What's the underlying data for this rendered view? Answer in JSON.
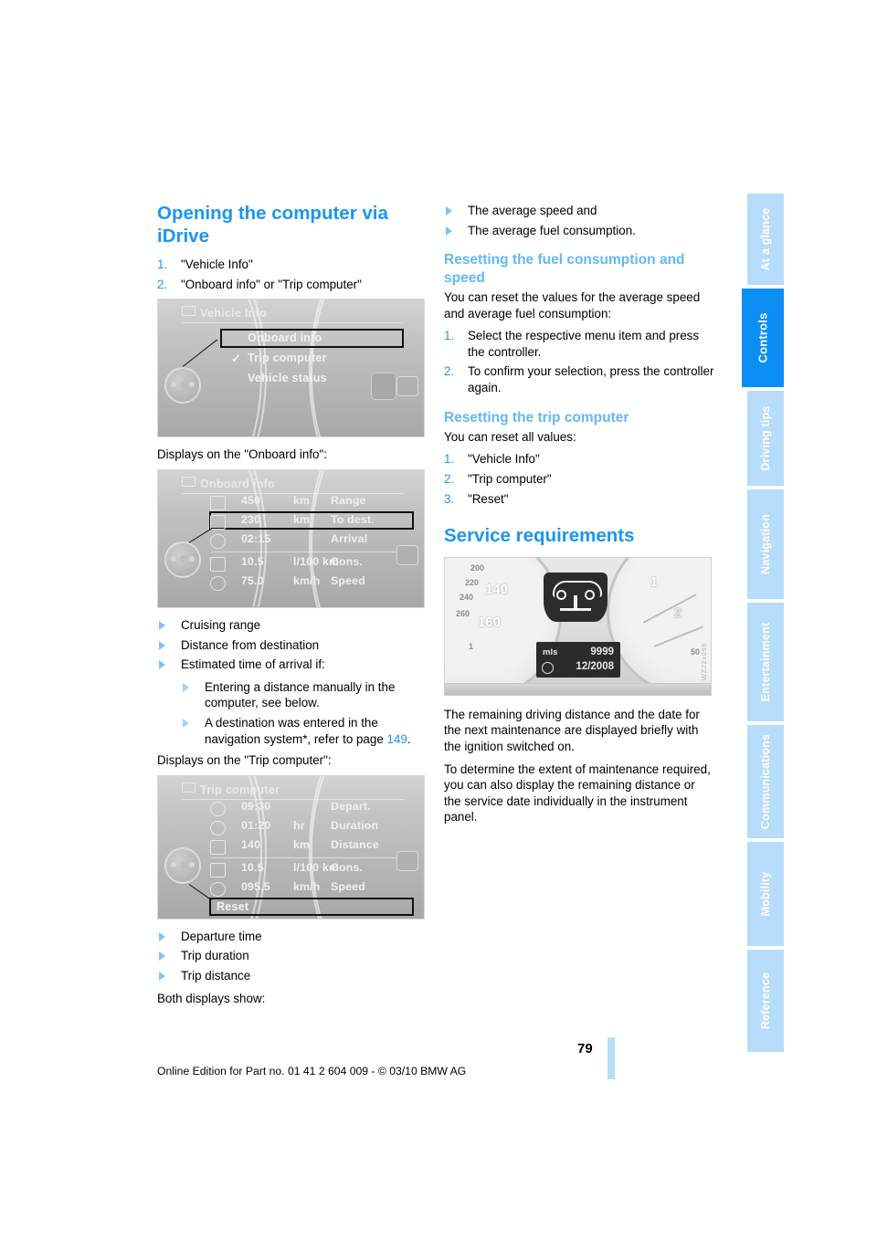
{
  "sidebar": {
    "tabs": [
      {
        "label": "At a glance",
        "active": false
      },
      {
        "label": "Controls",
        "active": true
      },
      {
        "label": "Driving tips",
        "active": false
      },
      {
        "label": "Navigation",
        "active": false
      },
      {
        "label": "Entertainment",
        "active": false
      },
      {
        "label": "Communications",
        "active": false
      },
      {
        "label": "Mobility",
        "active": false
      },
      {
        "label": "Reference",
        "active": false
      }
    ],
    "active_color": "#0b8ff5",
    "inactive_color": "#b8dcfb"
  },
  "left": {
    "heading": "Opening the computer via iDrive",
    "steps": [
      {
        "num": "1.",
        "text": "\"Vehicle Info\""
      },
      {
        "num": "2.",
        "text": "\"Onboard info\" or \"Trip computer\""
      }
    ],
    "caption_onboard": "Displays on the \"Onboard info\":",
    "caption_trip": "Displays on the \"Trip computer\":",
    "bullets_onboard": [
      "Cruising range",
      "Distance from destination",
      "Estimated time of arrival if:"
    ],
    "bullets_nested": [
      {
        "text": "Entering a distance manually in the computer, see below."
      },
      {
        "pre": "A destination was entered in the navigation system",
        "ast": "*",
        "mid": ", refer to page ",
        "page": "149",
        "post": "."
      }
    ],
    "bullets_trip": [
      "Departure time",
      "Trip duration",
      "Trip distance"
    ],
    "both_caption": "Both displays show:"
  },
  "figures": {
    "vehicle_info": {
      "title": "Vehicle Info",
      "items": [
        {
          "label": "Onboard info",
          "selected": true,
          "checked": false
        },
        {
          "label": "Trip computer",
          "selected": false,
          "checked": true
        },
        {
          "label": "Vehicle status",
          "selected": false,
          "checked": false
        }
      ]
    },
    "onboard_info": {
      "title": "Onboard info",
      "rows": [
        {
          "value": "450",
          "unit": "km",
          "label": "Range",
          "selected": false
        },
        {
          "value": "230",
          "unit": "km",
          "label": "To dest.",
          "selected": true
        },
        {
          "value": "02:15",
          "unit": "",
          "label": "Arrival",
          "selected": false
        },
        {
          "value": "10.5",
          "unit": "l/100 km",
          "label": "Cons.",
          "selected": false
        },
        {
          "value": "75.0",
          "unit": "km/h",
          "label": "Speed",
          "selected": false
        }
      ]
    },
    "trip_computer": {
      "title": "Trip computer",
      "rows": [
        {
          "value": "09:30",
          "unit": "",
          "label": "Depart."
        },
        {
          "value": "01:20",
          "unit": "hr",
          "label": "Duration"
        },
        {
          "value": "140",
          "unit": "km",
          "label": "Distance"
        },
        {
          "value": "10.5",
          "unit": "l/100 km",
          "label": "Cons."
        },
        {
          "value": "095.5",
          "unit": "km/h",
          "label": "Speed"
        }
      ],
      "reset_label": "Reset"
    },
    "cluster": {
      "speed_labels": [
        "200",
        "220",
        "240",
        "260",
        "1"
      ],
      "big_left": "140",
      "big_left2": "160",
      "tach_labels": [
        "1",
        "2",
        "50"
      ],
      "lcd_unit": "mls",
      "lcd_distance": "9999",
      "lcd_date": "12/2008",
      "watermark": "WZ22x095"
    }
  },
  "right": {
    "bullets_top": [
      "The average speed and",
      "The average fuel consumption."
    ],
    "sub_reset_fuel": "Resetting the fuel consumption and speed",
    "reset_fuel_intro": "You can reset the values for the average speed and average fuel consumption:",
    "reset_fuel_steps": [
      {
        "num": "1.",
        "text": "Select the respective menu item and press the controller."
      },
      {
        "num": "2.",
        "text": "To confirm your selection, press the controller again."
      }
    ],
    "sub_reset_trip": "Resetting the trip computer",
    "reset_trip_intro": "You can reset all values:",
    "reset_trip_steps": [
      {
        "num": "1.",
        "text": "\"Vehicle Info\""
      },
      {
        "num": "2.",
        "text": "\"Trip computer\""
      },
      {
        "num": "3.",
        "text": "\"Reset\""
      }
    ],
    "service_heading": "Service requirements",
    "service_p1": "The remaining driving distance and the date for the next maintenance are displayed briefly with the ignition switched on.",
    "service_p2": "To determine the extent of maintenance required, you can also display the remaining distance or the service date individually in the instrument panel."
  },
  "footer": {
    "page_number": "79",
    "line": "Online Edition for Part no. 01 41 2 604 009 - © 03/10 BMW AG"
  }
}
